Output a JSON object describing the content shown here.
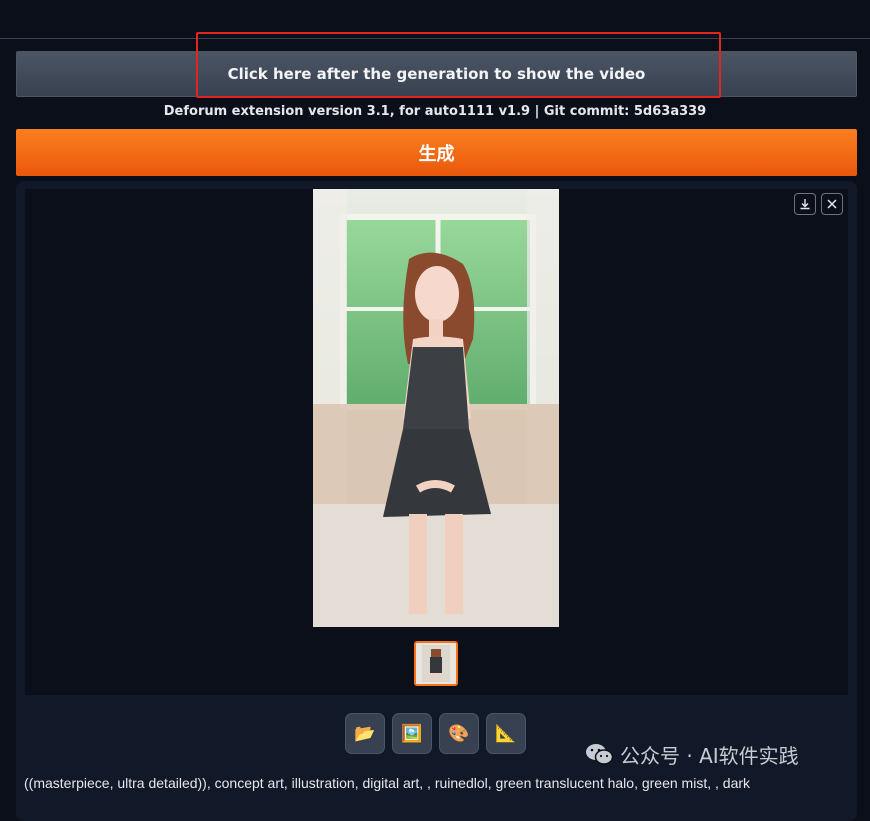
{
  "show_video_button": {
    "label": "Click here after the generation to show the video"
  },
  "version_line": "Deforum extension version 3.1, for auto1111 v1.9 | Git commit: 5d63a339",
  "generate_button": {
    "label": "生成"
  },
  "gallery": {
    "download_icon": "download-icon",
    "close_icon": "close-icon"
  },
  "tools": [
    {
      "name": "folder",
      "glyph": "📂"
    },
    {
      "name": "image",
      "glyph": "🖼️"
    },
    {
      "name": "palette",
      "glyph": "🎨"
    },
    {
      "name": "triangle-ruler",
      "glyph": "📐"
    }
  ],
  "watermark": {
    "text": "公众号 · AI软件实践"
  },
  "prompt_text": "((masterpiece, ultra detailed)), concept art, illustration, digital art, , ruinedlol, green translucent halo, green mist, , dark"
}
